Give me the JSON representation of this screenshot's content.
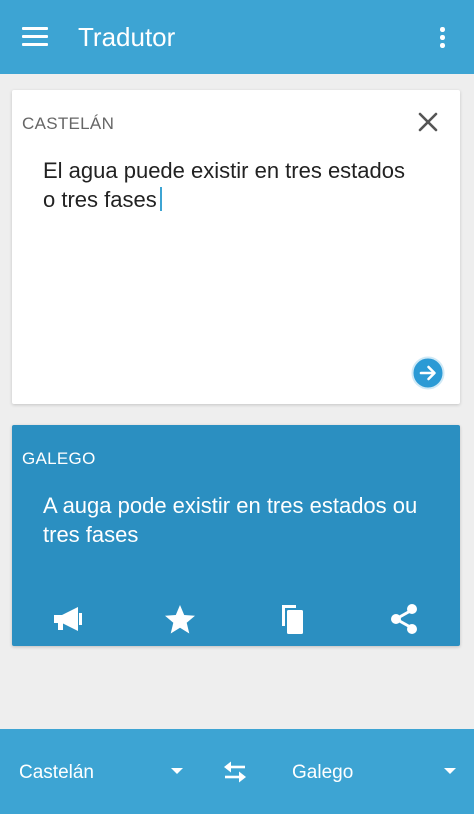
{
  "app_bar": {
    "title": "Tradutor",
    "menu_icon": "hamburger-menu-icon",
    "more_icon": "more-vert-icon",
    "color": "#3da4d3"
  },
  "source": {
    "language": "CASTELÁN",
    "text": "El agua puede existir en tres estados o tres fases",
    "clear_icon": "close-icon",
    "translate_icon": "arrow-forward-icon"
  },
  "target": {
    "language": "GALEGO",
    "text": "A auga pode existir en tres estados ou tres fases",
    "color": "#2b8fc1",
    "actions": [
      "speak-icon",
      "star-icon",
      "copy-icon",
      "share-icon"
    ]
  },
  "bottom_bar": {
    "from_language": "Castelán",
    "to_language": "Galego",
    "swap_icon": "swap-horiz-icon"
  }
}
